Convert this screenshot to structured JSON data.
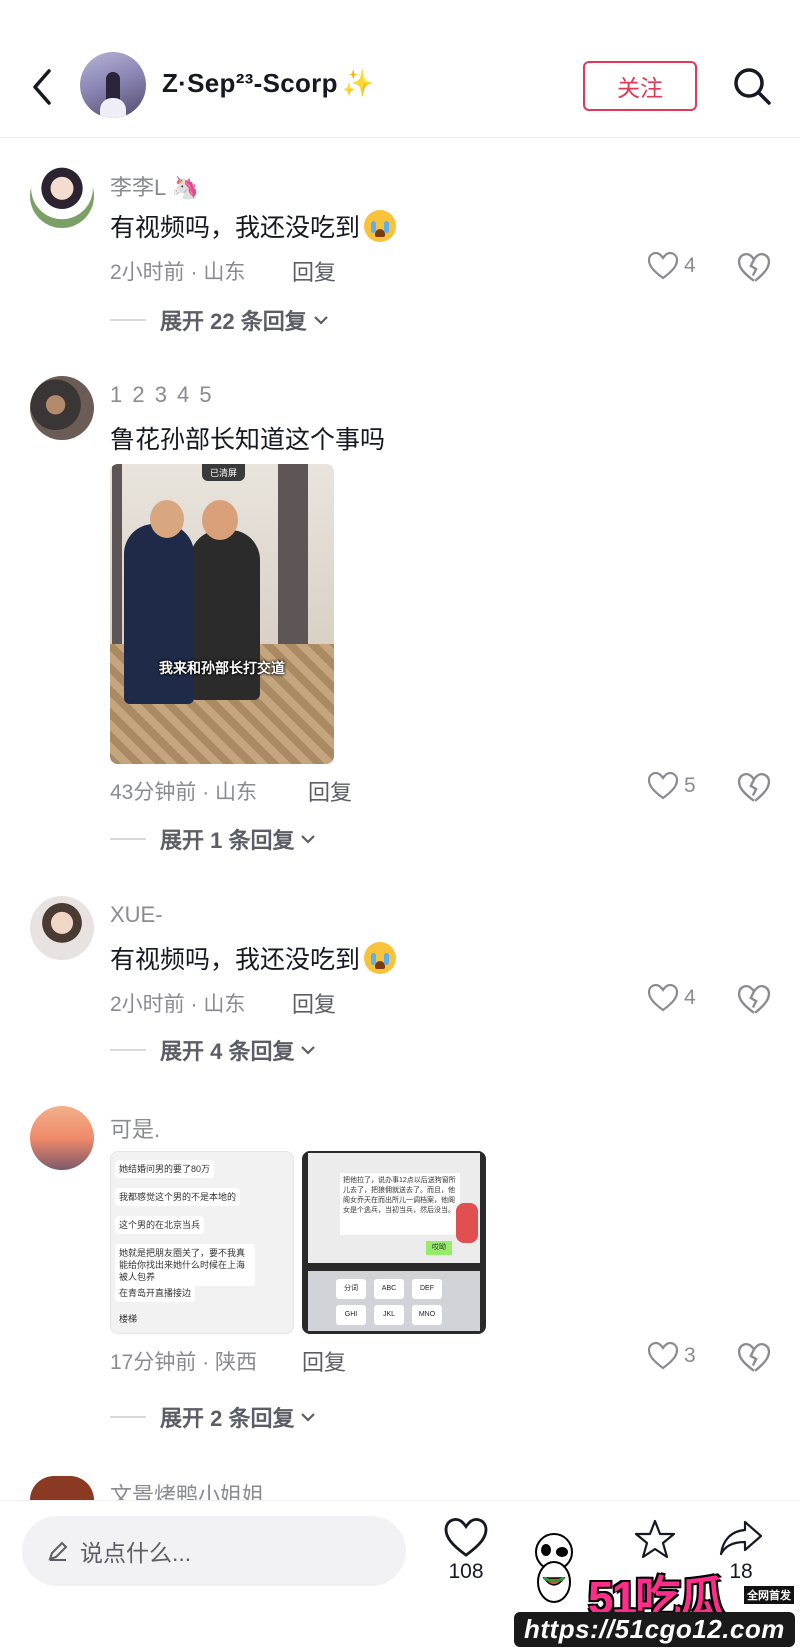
{
  "header": {
    "username": "Z·Sep²³-Scorp",
    "username_emoji": "✨",
    "follow_label": "关注"
  },
  "comments": [
    {
      "username": "李李L",
      "username_emoji": "🦄",
      "text": "有视频吗，我还没吃到",
      "time_location": "2小时前 · 山东",
      "reply_label": "回复",
      "likes": "4",
      "expand_label": "展开 22 条回复"
    },
    {
      "username": "1 2 3 4 5",
      "text": "鲁花孙部长知道这个事吗",
      "photo_caption": "我来和孙部长打交道",
      "photo_badge": "已清屏",
      "time_location": "43分钟前 · 山东",
      "reply_label": "回复",
      "likes": "5",
      "expand_label": "展开 1 条回复"
    },
    {
      "username": "XUE-",
      "text": "有视频吗，我还没吃到",
      "time_location": "2小时前 · 山东",
      "reply_label": "回复",
      "likes": "4",
      "expand_label": "展开 4 条回复"
    },
    {
      "username": "可是.",
      "chat_lines": [
        "她结婚问男的要了80万",
        "我都感觉这个男的不是本地的",
        "这个男的在北京当兵",
        "她就是把朋友圈关了，要不我真能给你找出来她什么时候在上海被人包养",
        "在青岛开直播接边",
        "楼梯"
      ],
      "chat_bubble": "把他拉了，说办事12点以后送狗窗所儿去了，把狼佣就送去了。而且，他阁女乔天在而出所儿一调档案，他阁女是个逃兵，当初当兵，然后没当。",
      "chat_green": "哎呦",
      "keyboard_keys": [
        "分词",
        "ABC",
        "DEF",
        "GHI",
        "JKL",
        "MNO"
      ],
      "time_location": "17分钟前 · 陕西",
      "reply_label": "回复",
      "likes": "3",
      "expand_label": "展开 2 条回复"
    },
    {
      "username": "文景烤鸭小姐姐"
    }
  ],
  "bottom_bar": {
    "input_placeholder": "说点什么...",
    "likes_count": "108",
    "share_count": "18"
  },
  "watermark": {
    "logo_text": "51吃瓜",
    "tag": "全网首发",
    "url": "https://51cgo12.com"
  },
  "colors": {
    "accent": "#e0395a",
    "text_primary": "#161823",
    "text_secondary": "#8a8b91"
  }
}
